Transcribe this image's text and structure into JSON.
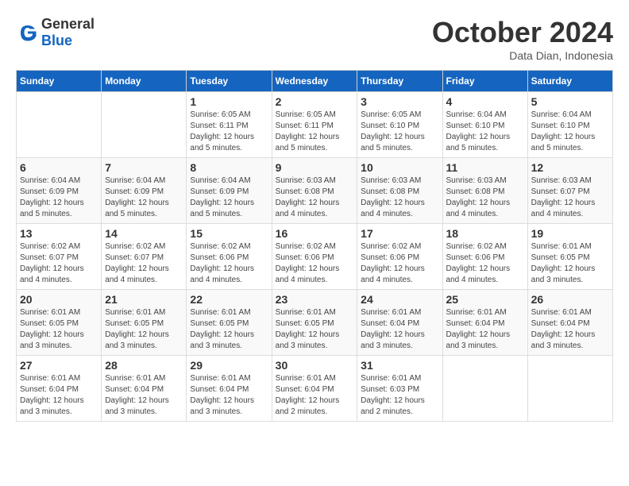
{
  "header": {
    "logo_general": "General",
    "logo_blue": "Blue",
    "month_title": "October 2024",
    "subtitle": "Data Dian, Indonesia"
  },
  "weekdays": [
    "Sunday",
    "Monday",
    "Tuesday",
    "Wednesday",
    "Thursday",
    "Friday",
    "Saturday"
  ],
  "weeks": [
    [
      {
        "day": "",
        "info": ""
      },
      {
        "day": "",
        "info": ""
      },
      {
        "day": "1",
        "info": "Sunrise: 6:05 AM\nSunset: 6:11 PM\nDaylight: 12 hours and 5 minutes."
      },
      {
        "day": "2",
        "info": "Sunrise: 6:05 AM\nSunset: 6:11 PM\nDaylight: 12 hours and 5 minutes."
      },
      {
        "day": "3",
        "info": "Sunrise: 6:05 AM\nSunset: 6:10 PM\nDaylight: 12 hours and 5 minutes."
      },
      {
        "day": "4",
        "info": "Sunrise: 6:04 AM\nSunset: 6:10 PM\nDaylight: 12 hours and 5 minutes."
      },
      {
        "day": "5",
        "info": "Sunrise: 6:04 AM\nSunset: 6:10 PM\nDaylight: 12 hours and 5 minutes."
      }
    ],
    [
      {
        "day": "6",
        "info": "Sunrise: 6:04 AM\nSunset: 6:09 PM\nDaylight: 12 hours and 5 minutes."
      },
      {
        "day": "7",
        "info": "Sunrise: 6:04 AM\nSunset: 6:09 PM\nDaylight: 12 hours and 5 minutes."
      },
      {
        "day": "8",
        "info": "Sunrise: 6:04 AM\nSunset: 6:09 PM\nDaylight: 12 hours and 5 minutes."
      },
      {
        "day": "9",
        "info": "Sunrise: 6:03 AM\nSunset: 6:08 PM\nDaylight: 12 hours and 4 minutes."
      },
      {
        "day": "10",
        "info": "Sunrise: 6:03 AM\nSunset: 6:08 PM\nDaylight: 12 hours and 4 minutes."
      },
      {
        "day": "11",
        "info": "Sunrise: 6:03 AM\nSunset: 6:08 PM\nDaylight: 12 hours and 4 minutes."
      },
      {
        "day": "12",
        "info": "Sunrise: 6:03 AM\nSunset: 6:07 PM\nDaylight: 12 hours and 4 minutes."
      }
    ],
    [
      {
        "day": "13",
        "info": "Sunrise: 6:02 AM\nSunset: 6:07 PM\nDaylight: 12 hours and 4 minutes."
      },
      {
        "day": "14",
        "info": "Sunrise: 6:02 AM\nSunset: 6:07 PM\nDaylight: 12 hours and 4 minutes."
      },
      {
        "day": "15",
        "info": "Sunrise: 6:02 AM\nSunset: 6:06 PM\nDaylight: 12 hours and 4 minutes."
      },
      {
        "day": "16",
        "info": "Sunrise: 6:02 AM\nSunset: 6:06 PM\nDaylight: 12 hours and 4 minutes."
      },
      {
        "day": "17",
        "info": "Sunrise: 6:02 AM\nSunset: 6:06 PM\nDaylight: 12 hours and 4 minutes."
      },
      {
        "day": "18",
        "info": "Sunrise: 6:02 AM\nSunset: 6:06 PM\nDaylight: 12 hours and 4 minutes."
      },
      {
        "day": "19",
        "info": "Sunrise: 6:01 AM\nSunset: 6:05 PM\nDaylight: 12 hours and 3 minutes."
      }
    ],
    [
      {
        "day": "20",
        "info": "Sunrise: 6:01 AM\nSunset: 6:05 PM\nDaylight: 12 hours and 3 minutes."
      },
      {
        "day": "21",
        "info": "Sunrise: 6:01 AM\nSunset: 6:05 PM\nDaylight: 12 hours and 3 minutes."
      },
      {
        "day": "22",
        "info": "Sunrise: 6:01 AM\nSunset: 6:05 PM\nDaylight: 12 hours and 3 minutes."
      },
      {
        "day": "23",
        "info": "Sunrise: 6:01 AM\nSunset: 6:05 PM\nDaylight: 12 hours and 3 minutes."
      },
      {
        "day": "24",
        "info": "Sunrise: 6:01 AM\nSunset: 6:04 PM\nDaylight: 12 hours and 3 minutes."
      },
      {
        "day": "25",
        "info": "Sunrise: 6:01 AM\nSunset: 6:04 PM\nDaylight: 12 hours and 3 minutes."
      },
      {
        "day": "26",
        "info": "Sunrise: 6:01 AM\nSunset: 6:04 PM\nDaylight: 12 hours and 3 minutes."
      }
    ],
    [
      {
        "day": "27",
        "info": "Sunrise: 6:01 AM\nSunset: 6:04 PM\nDaylight: 12 hours and 3 minutes."
      },
      {
        "day": "28",
        "info": "Sunrise: 6:01 AM\nSunset: 6:04 PM\nDaylight: 12 hours and 3 minutes."
      },
      {
        "day": "29",
        "info": "Sunrise: 6:01 AM\nSunset: 6:04 PM\nDaylight: 12 hours and 3 minutes."
      },
      {
        "day": "30",
        "info": "Sunrise: 6:01 AM\nSunset: 6:04 PM\nDaylight: 12 hours and 2 minutes."
      },
      {
        "day": "31",
        "info": "Sunrise: 6:01 AM\nSunset: 6:03 PM\nDaylight: 12 hours and 2 minutes."
      },
      {
        "day": "",
        "info": ""
      },
      {
        "day": "",
        "info": ""
      }
    ]
  ]
}
